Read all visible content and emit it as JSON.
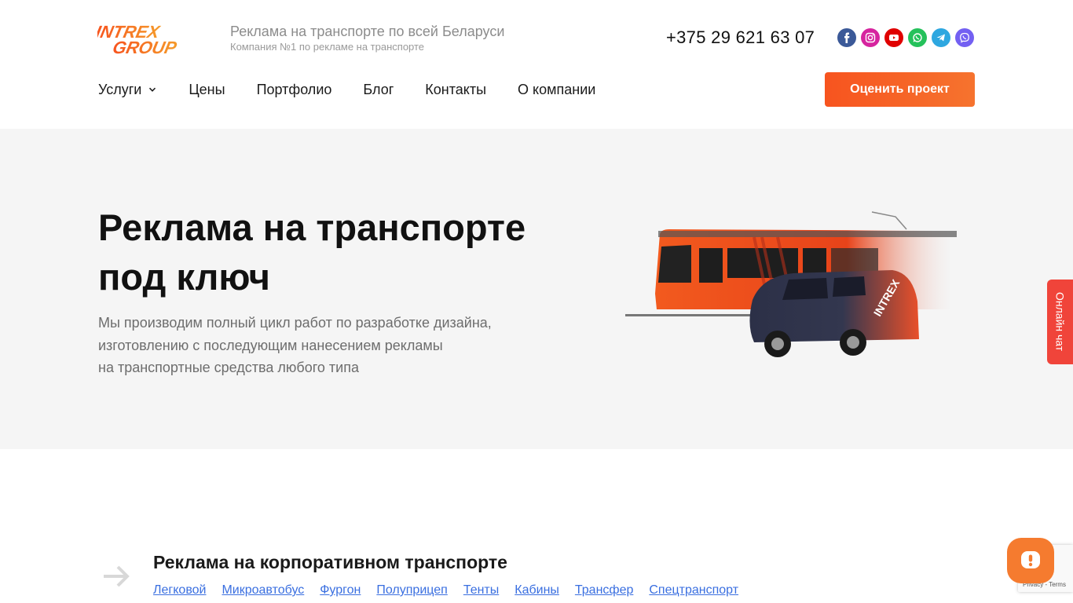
{
  "header": {
    "logo_text": "INTREX GROUP",
    "tagline": "Реклама на транспорте по всей Беларуси",
    "subtagline": "Компания №1 по рекламе на транспорте",
    "phone": "+375 29 621 63 07",
    "socials": [
      {
        "icon": "facebook-icon",
        "color": "#3b5998"
      },
      {
        "icon": "instagram-icon",
        "color": "#d6249f"
      },
      {
        "icon": "youtube-icon",
        "color": "#e00000"
      },
      {
        "icon": "whatsapp-icon",
        "color": "#25c15b"
      },
      {
        "icon": "telegram-icon",
        "color": "#2ea7e0"
      },
      {
        "icon": "viber-icon",
        "color": "#7360f2"
      }
    ]
  },
  "nav": {
    "items": [
      "Услуги",
      "Цены",
      "Портфолио",
      "Блог",
      "Контакты",
      "О компании"
    ],
    "cta": "Оценить проект"
  },
  "hero": {
    "title_line1": "Реклама на транспорте",
    "title_line2": "под ключ",
    "desc_line1": "Мы производим полный цикл работ по разработке дизайна,",
    "desc_line2": "изготовлению с последующим нанесением рекламы",
    "desc_line3": "на транспортные средства любого типа"
  },
  "side_chat": {
    "label": "Онлайн чат"
  },
  "services": {
    "title": "Реклама на корпоративном транспорте",
    "links": [
      "Легковой",
      "Микроавтобус",
      "Фургон",
      "Полуприцеп",
      "Тенты",
      "Кабины",
      "Трансфер",
      "Спецтранспорт"
    ]
  },
  "recaptcha": {
    "text": "Privacy - Terms"
  },
  "colors": {
    "accent": "#f7541f",
    "link": "#3a6fe0",
    "hero_bg": "#f5f5f5"
  }
}
